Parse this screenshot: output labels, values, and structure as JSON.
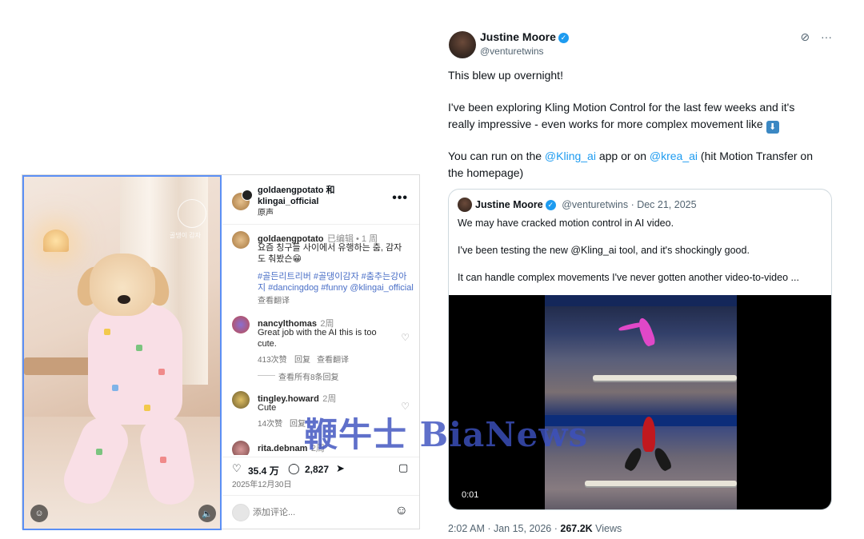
{
  "instagram": {
    "media": {
      "watermark_text": "골댕이 감자",
      "user_icon": "person-icon",
      "sound_icon": "speaker-icon"
    },
    "header": {
      "author_line1": "goldaengpotato 和",
      "author_line2": "klingai_official",
      "subtitle": "原声",
      "more_label": "•••"
    },
    "caption": {
      "user": "goldaengpotato",
      "meta": "已编辑 • 1 周",
      "text": "요즘 칭구들 사이에서 유행하는 춤, 감자도 춰봤슨😁",
      "tags": "#골든리트리버 #골댕이감자 #춤추는강아지 #dancingdog #funny @klingai_official",
      "translate": "查看翻译"
    },
    "comments": [
      {
        "user": "nancylthomas",
        "age": "2周",
        "text": "Great job with the AI this is too cute.",
        "likes": "413次赞",
        "reply": "回复",
        "translate": "查看翻译",
        "view_replies": "查看所有8条回复"
      },
      {
        "user": "tingley.howard",
        "age": "2周",
        "text": "Cute",
        "likes": "14次赞",
        "reply": "回复"
      },
      {
        "user": "rita.debnam",
        "age": "2周"
      }
    ],
    "actions": {
      "like_count": "35.4 万",
      "comment_count": "2,827",
      "date": "2025年12月30日"
    },
    "comment_input": {
      "placeholder": "添加评论..."
    }
  },
  "tweet": {
    "author": "Justine Moore",
    "handle": "@venturetwins",
    "line1": "This blew up overnight!",
    "line2a": "I've been exploring Kling Motion Control for the last few weeks and it's",
    "line2b": "really impressive - even works for more complex movement like",
    "line3a_pre": "You can run on the ",
    "mention1": "@Kling_ai",
    "line3a_mid": " app or on ",
    "mention2": "@krea_ai",
    "line3a_post": " (hit Motion Transfer on",
    "line3b": "the homepage)",
    "quote": {
      "author": "Justine Moore",
      "handle_date": "@venturetwins · Dec 21, 2025",
      "p1": "We may have cracked motion control in AI video.",
      "p2": "I've been testing the new @Kling_ai tool, and it's shockingly good.",
      "p3": "It can handle complex movements I've never gotten another video-to-video ...",
      "video_time": "0:01"
    },
    "footer_time": "2:02 AM · Jan 15, 2026 · ",
    "views_count": "267.2K",
    "views_label": " Views"
  },
  "overlay_watermark": "鞭牛士 BiaNews"
}
